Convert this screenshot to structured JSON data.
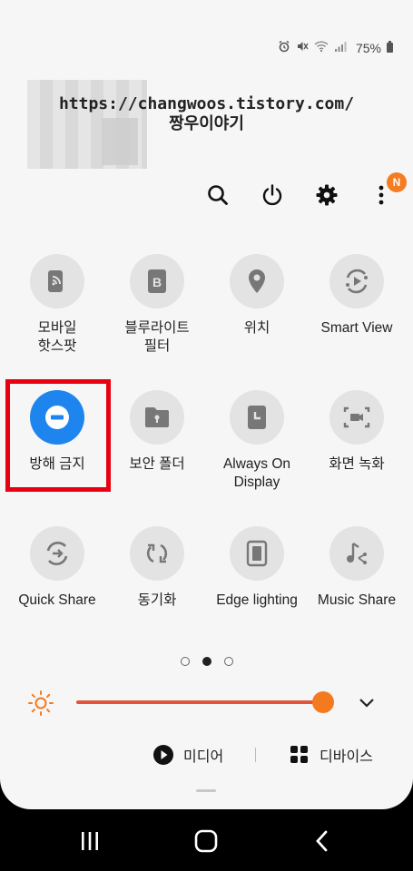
{
  "status_bar": {
    "battery_text": "75%",
    "icons": [
      "alarm-icon",
      "mute-icon",
      "wifi-icon",
      "signal-icon",
      "battery-icon"
    ]
  },
  "watermark": {
    "line1": "https://changwoos.tistory.com/",
    "line2": "짱우이야기"
  },
  "header_actions": {
    "badge": "N",
    "icons": [
      "search-icon",
      "power-icon",
      "settings-icon",
      "more-icon"
    ]
  },
  "tiles": [
    {
      "label": "모바일\n핫스팟",
      "icon": "hotspot-icon",
      "active": false
    },
    {
      "label": "블루라이트\n필터",
      "icon": "blue-light-filter-icon",
      "active": false
    },
    {
      "label": "위치",
      "icon": "location-icon",
      "active": false
    },
    {
      "label": "Smart View",
      "icon": "smart-view-icon",
      "active": false
    },
    {
      "label": "방해 금지",
      "icon": "do-not-disturb-icon",
      "active": true
    },
    {
      "label": "보안 폴더",
      "icon": "secure-folder-icon",
      "active": false
    },
    {
      "label": "Always On\nDisplay",
      "icon": "always-on-display-icon",
      "active": false
    },
    {
      "label": "화면 녹화",
      "icon": "screen-recorder-icon",
      "active": false
    },
    {
      "label": "Quick Share",
      "icon": "quick-share-icon",
      "active": false
    },
    {
      "label": "동기화",
      "icon": "sync-icon",
      "active": false
    },
    {
      "label": "Edge lighting",
      "icon": "edge-lighting-icon",
      "active": false
    },
    {
      "label": "Music Share",
      "icon": "music-share-icon",
      "active": false
    }
  ],
  "pages": {
    "count": 3,
    "current": 2
  },
  "brightness": {
    "level": 1.0,
    "accent": "#f47a20"
  },
  "media_row": {
    "media_label": "미디어",
    "devices_label": "디바이스"
  },
  "colors": {
    "active_tile": "#1f85ee",
    "highlight": "#e60012",
    "badge": "#f57c20"
  }
}
